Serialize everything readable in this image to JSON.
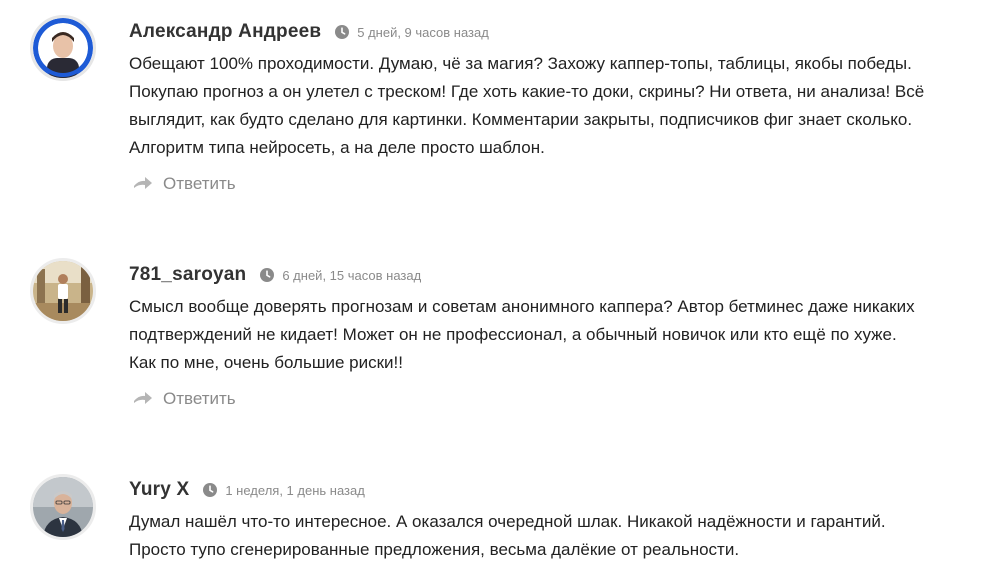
{
  "comments": [
    {
      "author": "Александр Андреев",
      "time": "5 дней, 9 часов назад",
      "lines": [
        "Обещают 100% проходимости. Думаю, чё за магия? Захожу каппер-топы, таблицы, якобы победы.",
        "Покупаю прогноз а он улетел с треском! Где хоть какие-то доки, скрины? Ни ответа, ни анализа! Всё",
        "выглядит, как будто сделано для картинки. Комментарии закрыты, подписчиков фиг знает сколько.",
        "Алгоритм типа нейросеть, а на деле просто шаблон."
      ],
      "reply_label": "Ответить"
    },
    {
      "author": "781_saroyan",
      "time": "6 дней, 15 часов назад",
      "lines": [
        "Смысл вообще доверять прогнозам и советам анонимного каппера? Автор бетминес даже никаких",
        "подтверждений не кидает! Может он не профессионал, а обычный новичок или кто ещё по хуже.",
        "Как по мне, очень большие риски!!"
      ],
      "reply_label": "Ответить"
    },
    {
      "author": "Yury X",
      "time": "1 неделя, 1 день назад",
      "lines": [
        "Думал нашёл что-то интересное. А оказался очередной шлак. Никакой надёжности и гарантий.",
        "Просто тупо сгенерированные предложения, весьма далёкие от реальности."
      ]
    }
  ],
  "icons": {
    "time": "clock-icon",
    "reply": "reply-arrow-icon"
  },
  "colors": {
    "author": "#333333",
    "meta": "#8a8a8a",
    "text": "#222222",
    "avatar_ring_blue": "#1e5bd6"
  }
}
